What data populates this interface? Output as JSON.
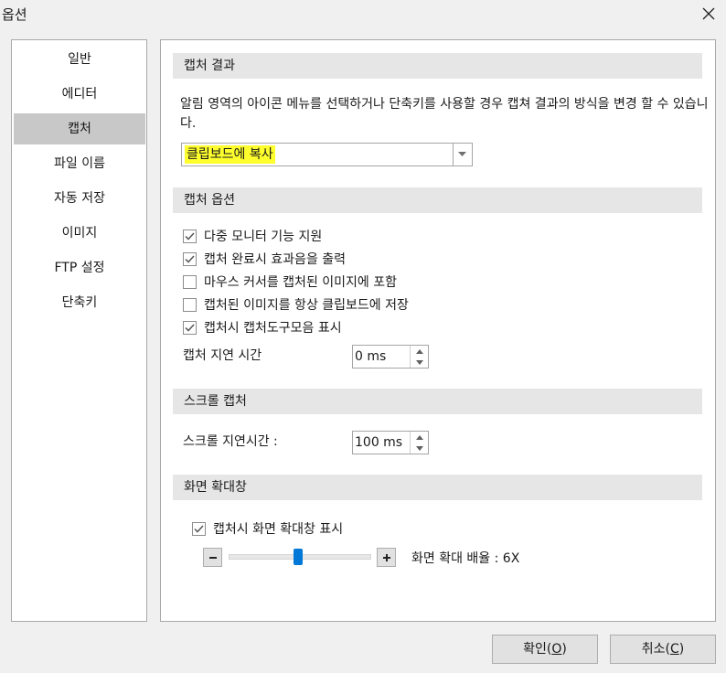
{
  "window": {
    "title": "옵션",
    "close_icon": "close-icon"
  },
  "sidebar": {
    "items": [
      {
        "label": "일반"
      },
      {
        "label": "에디터"
      },
      {
        "label": "캡처",
        "selected": true
      },
      {
        "label": "파일 이름"
      },
      {
        "label": "자동 저장"
      },
      {
        "label": "이미지"
      },
      {
        "label": "FTP 설정"
      },
      {
        "label": "단축키"
      }
    ]
  },
  "capture_result": {
    "header": "캡처 결과",
    "description": "알림 영역의 아이콘 메뉴를 선택하거나 단축키를 사용할 경우 캡쳐 결과의 방식을 변경 할 수 있습니다.",
    "selected_option": "클립보드에 복사",
    "highlight_color": "#ffff2e"
  },
  "capture_options": {
    "header": "캡처 옵션",
    "checkboxes": [
      {
        "label": "다중 모니터 기능 지원",
        "checked": true
      },
      {
        "label": "캡처 완료시 효과음을 출력",
        "checked": true
      },
      {
        "label": "마우스 커서를 캡처된 이미지에 포함",
        "checked": false
      },
      {
        "label": "캡처된 이미지를 항상 클립보드에 저장",
        "checked": false
      },
      {
        "label": "캡처시 캡처도구모음 표시",
        "checked": true
      }
    ],
    "delay_label": "캡처 지연 시간",
    "delay_value": "0 ms"
  },
  "scroll_capture": {
    "header": "스크롤 캡처",
    "delay_label": "스크롤 지연시간 :",
    "delay_value": "100 ms"
  },
  "magnifier": {
    "header": "화면 확대창",
    "show_label": "캡처시 화면 확대창 표시",
    "show_checked": true,
    "zoom_label": "화면 확대 배율 : 6X",
    "zoom_level_fraction": 0.5,
    "accent_color": "#0078d7"
  },
  "footer": {
    "ok_prefix": "확인(",
    "ok_key": "O",
    "ok_suffix": ")",
    "cancel_prefix": "취소(",
    "cancel_key": "C",
    "cancel_suffix": ")"
  }
}
